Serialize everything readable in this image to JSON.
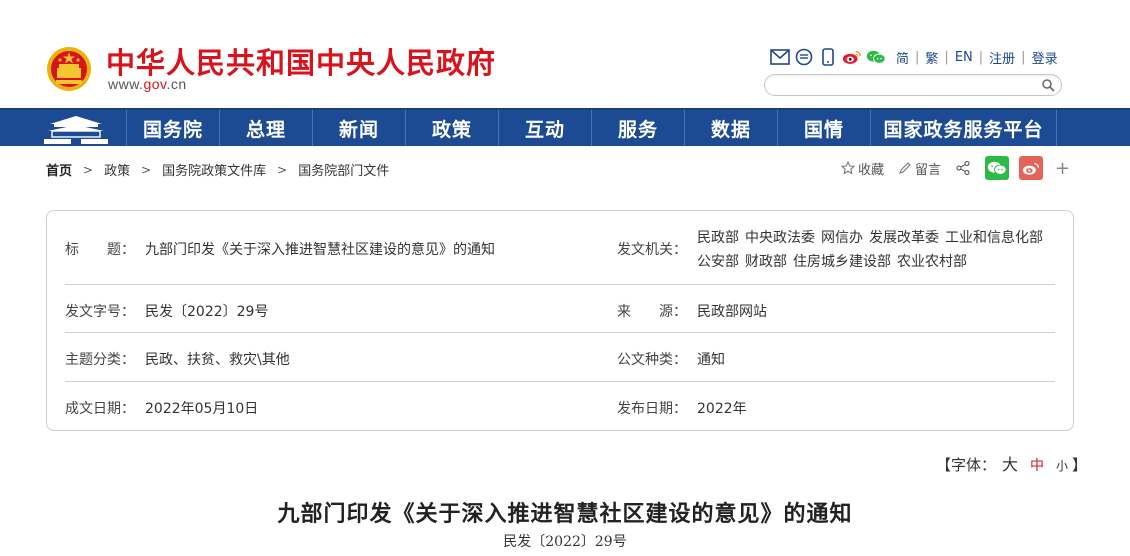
{
  "header": {
    "site_title": "中华人民共和国中央人民政府",
    "site_url_prefix": "www.",
    "site_url_highlight": "gov",
    "site_url_suffix": ".cn",
    "icons": [
      "mail-icon",
      "chat-bubble-icon",
      "mobile-icon",
      "weibo-icon",
      "wechat-icon"
    ],
    "links": [
      "简",
      "繁",
      "EN",
      "注册",
      "登录"
    ],
    "search_placeholder": ""
  },
  "nav": {
    "items": [
      "国务院",
      "总理",
      "新闻",
      "政策",
      "互动",
      "服务",
      "数据",
      "国情",
      "国家政务服务平台"
    ]
  },
  "breadcrumb": {
    "items": [
      "首页",
      "政策",
      "国务院政策文件库",
      "国务院部门文件"
    ]
  },
  "tools": {
    "favorite": "收藏",
    "comment": "留言"
  },
  "info": {
    "title_label": "标　　题：",
    "title_value": "九部门印发《关于深入推进智慧社区建设的意见》的通知",
    "issuer_label": "发文机关：",
    "issuers": [
      "民政部",
      "中央政法委",
      "网信办",
      "发展改革委",
      "工业和信息化部",
      "公安部",
      "财政部",
      "住房城乡建设部",
      "农业农村部"
    ],
    "doc_no_label": "发文字号：",
    "doc_no_value": "民发〔2022〕29号",
    "source_label": "来　　源：",
    "source_value": "民政部网站",
    "topic_label": "主题分类：",
    "topic_value": "民政、扶贫、救灾\\其他",
    "type_label": "公文种类：",
    "type_value": "通知",
    "date_label": "成文日期：",
    "date_value": "2022年05月10日",
    "publish_label": "发布日期：",
    "publish_value": "2022年"
  },
  "fontsize": {
    "prefix": "【字体：",
    "big": "大",
    "mid": "中",
    "small": "小",
    "suffix": "】"
  },
  "article": {
    "title": "九部门印发《关于深入推进智慧社区建设的意见》的通知",
    "doc_no": "民发〔2022〕29号"
  },
  "colors": {
    "brand_red": "#d9131c",
    "nav_blue": "#1d4b93",
    "link_blue": "#1e4a8c",
    "wechat_green": "#2dbb47",
    "weibo_red": "#e46459"
  }
}
